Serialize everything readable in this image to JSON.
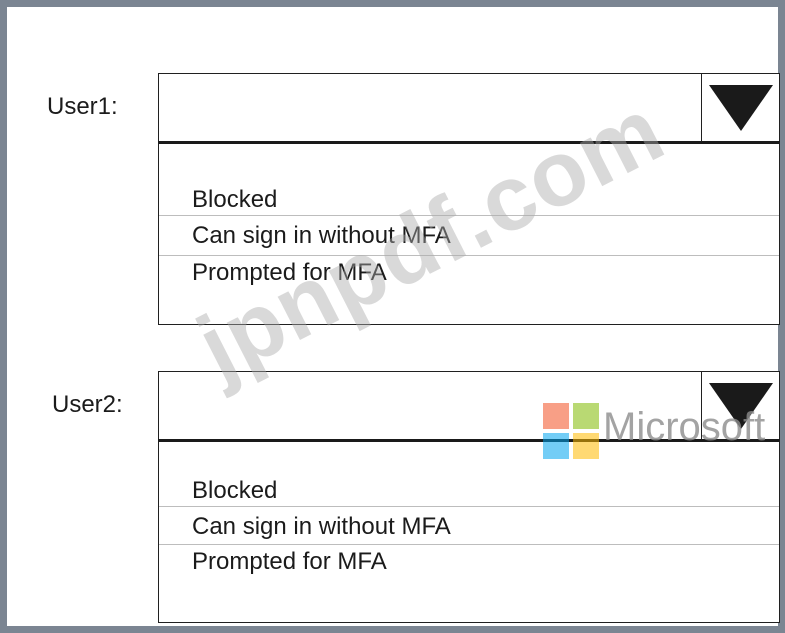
{
  "user1": {
    "label": "User1:",
    "selected_value": "",
    "options": [
      "Blocked",
      "Can sign in without MFA",
      "Prompted for MFA"
    ]
  },
  "user2": {
    "label": "User2:",
    "selected_value": "",
    "options": [
      "Blocked",
      "Can sign in without MFA",
      "Prompted for MFA"
    ]
  },
  "watermark": {
    "site_text": "jpnpdf.com",
    "brand_text": "Microsoft",
    "logo_colors": [
      "#f25022",
      "#7fba00",
      "#00a4ef",
      "#ffb900"
    ]
  },
  "icons": {
    "dropdown_caret": "triangle-down-icon",
    "brand_logo": "microsoft-logo-icon"
  }
}
